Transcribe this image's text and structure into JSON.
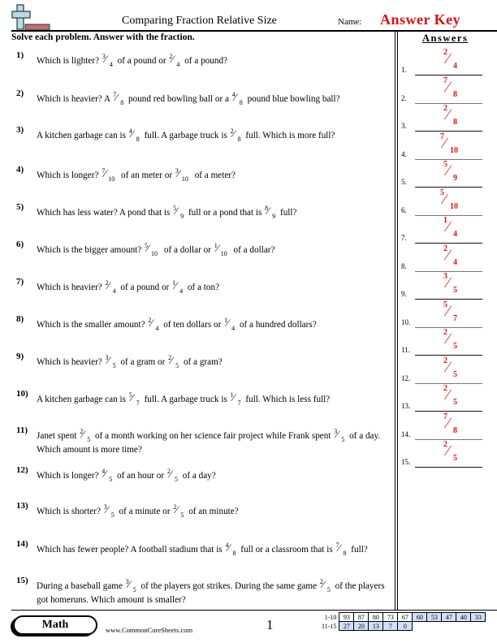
{
  "header": {
    "title": "Comparing Fraction Relative Size",
    "name_label": "Name:",
    "name_value": "Answer Key",
    "logo_icon": "plus-minus-logo-icon"
  },
  "instructions": "Solve each problem. Answer with the fraction.",
  "answers_title": "Answers",
  "questions": [
    {
      "num": "1)",
      "parts": [
        "Which is lighter? ",
        {
          "n": "3",
          "d": "4"
        },
        " of a pound or ",
        {
          "n": "2",
          "d": "4"
        },
        " of a pound?"
      ]
    },
    {
      "num": "2)",
      "parts": [
        "Which is heavier? A ",
        {
          "n": "7",
          "d": "8"
        },
        " pound red bowling ball or a ",
        {
          "n": "4",
          "d": "8"
        },
        " pound blue bowling ball?"
      ]
    },
    {
      "num": "3)",
      "parts": [
        "A kitchen garbage can is ",
        {
          "n": "4",
          "d": "8"
        },
        " full. A garbage truck is ",
        {
          "n": "2",
          "d": "8"
        },
        " full. Which is more full?"
      ]
    },
    {
      "num": "4)",
      "parts": [
        "Which is longer? ",
        {
          "n": "7",
          "d": "10"
        },
        " of an meter or ",
        {
          "n": "3",
          "d": "10"
        },
        " of a meter?"
      ]
    },
    {
      "num": "5)",
      "parts": [
        "Which has less water? A pond that is ",
        {
          "n": "5",
          "d": "9"
        },
        " full or a pond that is ",
        {
          "n": "8",
          "d": "9"
        },
        " full?"
      ]
    },
    {
      "num": "6)",
      "parts": [
        "Which is the bigger amount? ",
        {
          "n": "5",
          "d": "10"
        },
        " of a dollar or ",
        {
          "n": "1",
          "d": "10"
        },
        " of a dollar?"
      ]
    },
    {
      "num": "7)",
      "parts": [
        "Which is heavier? ",
        {
          "n": "2",
          "d": "4"
        },
        " of a pound or ",
        {
          "n": "1",
          "d": "4"
        },
        " of a ton?"
      ]
    },
    {
      "num": "8)",
      "parts": [
        "Which is the smaller amount? ",
        {
          "n": "2",
          "d": "4"
        },
        " of ten dollars or ",
        {
          "n": "1",
          "d": "4"
        },
        " of a hundred dollars?"
      ]
    },
    {
      "num": "9)",
      "parts": [
        "Which is heavier? ",
        {
          "n": "3",
          "d": "5"
        },
        " of a gram or ",
        {
          "n": "2",
          "d": "5"
        },
        " of a gram?"
      ]
    },
    {
      "num": "10)",
      "parts": [
        "A kitchen garbage can is ",
        {
          "n": "5",
          "d": "7"
        },
        " full. A garbage truck is ",
        {
          "n": "1",
          "d": "7"
        },
        " full. Which is less full?"
      ]
    },
    {
      "num": "11)",
      "parts": [
        "Janet spent ",
        {
          "n": "2",
          "d": "5"
        },
        " of a month working on her science fair project while Frank spent ",
        {
          "n": "3",
          "d": "5"
        },
        " of a day. Which amount is more time?"
      ]
    },
    {
      "num": "12)",
      "parts": [
        "Which is longer? ",
        {
          "n": "4",
          "d": "5"
        },
        " of an hour or ",
        {
          "n": "2",
          "d": "5"
        },
        " of a day?"
      ]
    },
    {
      "num": "13)",
      "parts": [
        "Which is shorter? ",
        {
          "n": "3",
          "d": "5"
        },
        " of a minute or ",
        {
          "n": "2",
          "d": "5"
        },
        " of an minute?"
      ]
    },
    {
      "num": "14)",
      "parts": [
        "Which has fewer people? A football stadium that is ",
        {
          "n": "4",
          "d": "8"
        },
        " full or a classroom that is ",
        {
          "n": "7",
          "d": "8"
        },
        " full?"
      ]
    },
    {
      "num": "15)",
      "parts": [
        "During a baseball game ",
        {
          "n": "3",
          "d": "5"
        },
        " of the players got strikes. During the same game ",
        {
          "n": "2",
          "d": "5"
        },
        " of the players got homeruns. Which amount is smaller?"
      ]
    }
  ],
  "answers": [
    {
      "idx": "1.",
      "n": "2",
      "d": "4"
    },
    {
      "idx": "2.",
      "n": "7",
      "d": "8"
    },
    {
      "idx": "3.",
      "n": "2",
      "d": "8"
    },
    {
      "idx": "4.",
      "n": "7",
      "d": "10"
    },
    {
      "idx": "5.",
      "n": "5",
      "d": "9"
    },
    {
      "idx": "6.",
      "n": "5",
      "d": "10"
    },
    {
      "idx": "7.",
      "n": "1",
      "d": "4"
    },
    {
      "idx": "8.",
      "n": "2",
      "d": "4"
    },
    {
      "idx": "9.",
      "n": "3",
      "d": "5"
    },
    {
      "idx": "10.",
      "n": "5",
      "d": "7"
    },
    {
      "idx": "11.",
      "n": "2",
      "d": "5"
    },
    {
      "idx": "12.",
      "n": "2",
      "d": "5"
    },
    {
      "idx": "13.",
      "n": "2",
      "d": "5"
    },
    {
      "idx": "14.",
      "n": "7",
      "d": "8"
    },
    {
      "idx": "15.",
      "n": "2",
      "d": "5"
    }
  ],
  "footer": {
    "subject": "Math",
    "site": "www.CommonCoreSheets.com",
    "page": "1",
    "score_rows": [
      {
        "label": "1-10",
        "values": [
          "93",
          "87",
          "80",
          "73",
          "67",
          "60",
          "53",
          "47",
          "40",
          "33"
        ],
        "blue_from": 5
      },
      {
        "label": "11-15",
        "values": [
          "27",
          "20",
          "13",
          "7",
          "0"
        ],
        "blue_from": 0
      }
    ]
  },
  "colors": {
    "answer_red": "#e01010",
    "score_blue": "#cfe0f8"
  }
}
